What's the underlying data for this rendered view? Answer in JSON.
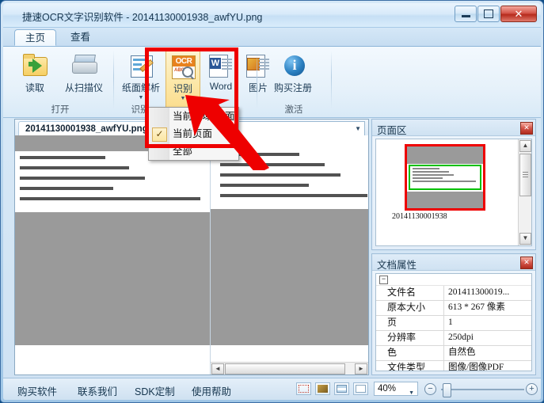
{
  "window": {
    "title": "捷速OCR文字识别软件 - 20141130001938_awfYU.png",
    "minimize_label": "",
    "maximize_label": "",
    "close_label": "✕"
  },
  "tabs": [
    {
      "label": "主页",
      "active": true
    },
    {
      "label": "查看",
      "active": false
    }
  ],
  "ribbon": {
    "groups": [
      {
        "label": "打开",
        "buttons": [
          {
            "label": "读取",
            "icon": "folder-open-icon",
            "has_arrow": false
          },
          {
            "label": "从扫描仪",
            "icon": "scanner-icon",
            "has_arrow": false
          }
        ]
      },
      {
        "label": "识别",
        "buttons": [
          {
            "label": "纸面解析",
            "icon": "page-analyze-icon",
            "has_arrow": true
          },
          {
            "label": "识别",
            "icon": "ocr-icon",
            "has_arrow": true,
            "selected": true
          },
          {
            "label": "Word",
            "icon": "word-export-icon",
            "has_arrow": false
          },
          {
            "label": "图片",
            "icon": "image-export-icon",
            "has_arrow": false
          }
        ]
      },
      {
        "label": "激活",
        "buttons": [
          {
            "label": "购买注册",
            "icon": "info-icon",
            "has_arrow": false
          }
        ]
      }
    ]
  },
  "dropdown_menu": {
    "items": [
      {
        "label": "当前区域/纸面",
        "checked": false
      },
      {
        "label": "当前页面",
        "checked": true
      },
      {
        "label": "全部",
        "checked": false
      }
    ],
    "check_glyph": "✓"
  },
  "document": {
    "tab_label": "20141130001938_awfYU.png",
    "combo_value": "",
    "left_pane": {
      "text_lines": [
        "我爱你，爱到失去了自己。",
        "原来不知何，我已经变成这样了。",
        "我的生活很充实，充实到再也不下我。",
        "看到你快乐，我很放心。",
        "在这段时间，我遇到的每个人都在说自己一个人，现在一个很多人都说，你要一个人很好好。"
      ]
    },
    "right_pane": {
      "text_lines": [
        "我爱你，爱到失去了自己。",
        "原来不知何，我已经变成这样了。",
        "我的生活很充实，充实到再也不下我。",
        "看到你快乐，我很放心。",
        "在这段时间，我遇到的每个人都在说自己一个人，现在一个很多人都说，你要一个人很好好。"
      ]
    },
    "hscroll": {
      "left_arrow": "◄",
      "right_arrow": "►",
      "grip": "|||"
    }
  },
  "page_panel": {
    "title": "页面区",
    "close_label": "✕",
    "thumbnail_caption": "20141130001938",
    "scroll": {
      "up_arrow": "▲",
      "down_arrow": "▼"
    }
  },
  "properties_panel": {
    "title": "文档属性",
    "close_label": "✕",
    "expander_glyph": "−",
    "rows": [
      {
        "key": "文件名",
        "value": "201411300019..."
      },
      {
        "key": "原本大小",
        "value": "613 * 267  像素"
      },
      {
        "key": "页",
        "value": "1"
      },
      {
        "key": "分辨率",
        "value": "250dpi"
      },
      {
        "key": "色",
        "value": "自然色"
      },
      {
        "key": "文件类型",
        "value": "图像/图像PDF"
      }
    ]
  },
  "statusbar": {
    "links": [
      {
        "label": "购买软件"
      },
      {
        "label": "联系我们"
      },
      {
        "label": "SDK定制"
      },
      {
        "label": "使用帮助"
      }
    ],
    "view_buttons": [
      {
        "name": "select-region-view"
      },
      {
        "name": "image-view"
      },
      {
        "name": "list-view"
      },
      {
        "name": "page-view"
      }
    ],
    "zoom_value": "40%",
    "zoom_out_label": "−",
    "zoom_in_label": "+"
  },
  "colors": {
    "annotation_red": "#ee0000",
    "selection_green": "#00c000",
    "ribbon_highlight": "#fce7a7",
    "accent_blue": "#2a7fc0"
  }
}
